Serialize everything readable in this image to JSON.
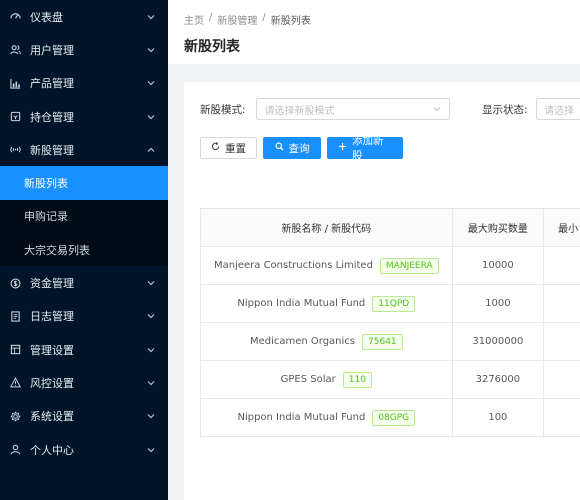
{
  "sidebar": {
    "items": [
      {
        "label": "仪表盘",
        "icon": "dashboard-icon",
        "arrow": "down"
      },
      {
        "label": "用户管理",
        "icon": "users-icon",
        "arrow": "down"
      },
      {
        "label": "产品管理",
        "icon": "chart-icon",
        "arrow": "down"
      },
      {
        "label": "持仓管理",
        "icon": "wallet-icon",
        "arrow": "down"
      },
      {
        "label": "新股管理",
        "icon": "signal-icon",
        "arrow": "up",
        "expanded": true
      }
    ],
    "sub_items": [
      {
        "label": "新股列表",
        "active": true
      },
      {
        "label": "申购记录",
        "active": false
      },
      {
        "label": "大宗交易列表",
        "active": false
      }
    ],
    "items_after": [
      {
        "label": "资金管理",
        "icon": "dollar-icon",
        "arrow": "down"
      },
      {
        "label": "日志管理",
        "icon": "log-icon",
        "arrow": "down"
      },
      {
        "label": "管理设置",
        "icon": "table-icon",
        "arrow": "down"
      },
      {
        "label": "风控设置",
        "icon": "warning-icon",
        "arrow": "down"
      },
      {
        "label": "系统设置",
        "icon": "gear-icon",
        "arrow": "down"
      },
      {
        "label": "个人中心",
        "icon": "user-icon",
        "arrow": "down"
      }
    ]
  },
  "header": {
    "breadcrumb": [
      "主页",
      "新股管理",
      "新股列表"
    ],
    "separator": "/",
    "title": "新股列表"
  },
  "filters": {
    "mode_label": "新股模式:",
    "mode_placeholder": "请选择新股模式",
    "status_label": "显示状态:",
    "status_placeholder": "请选择"
  },
  "buttons": {
    "reset": "重置",
    "search": "查询",
    "add": "添加新股"
  },
  "table": {
    "columns": [
      "新股名称 / 新股代码",
      "最大购买数量",
      "最小"
    ],
    "rows": [
      {
        "name": "Manjeera Constructions Limited",
        "code": "MANJEERA",
        "max_qty": "10000"
      },
      {
        "name": "Nippon India Mutual Fund",
        "code": "11QPD",
        "max_qty": "1000"
      },
      {
        "name": "Medicamen Organics",
        "code": "75641",
        "max_qty": "31000000"
      },
      {
        "name": "GPES Solar",
        "code": "110",
        "max_qty": "3276000"
      },
      {
        "name": "Nippon India Mutual Fund",
        "code": "08GPG",
        "max_qty": "100"
      }
    ]
  }
}
